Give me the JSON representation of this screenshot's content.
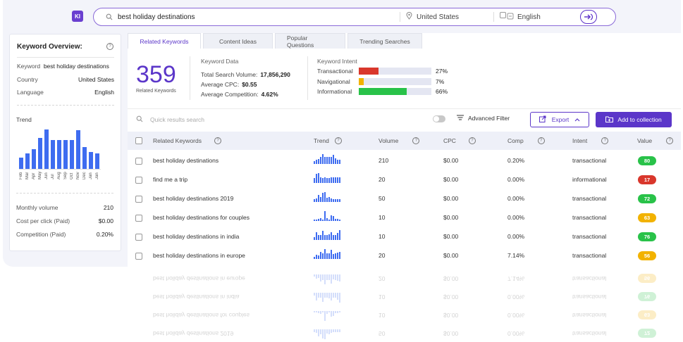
{
  "app": {
    "logo": "KI"
  },
  "search": {
    "query": "best holiday destinations",
    "country": "United States",
    "language": "English"
  },
  "overview": {
    "title": "Keyword Overview:",
    "keyword_label": "Keyword",
    "keyword_value": "best holiday destinations",
    "country_label": "Country",
    "country_value": "United States",
    "language_label": "Language",
    "language_value": "English",
    "trend_label": "Trend",
    "trend_values": [
      0.28,
      0.4,
      0.5,
      0.78,
      1.0,
      0.74,
      0.74,
      0.74,
      0.74,
      0.98,
      0.56,
      0.42,
      0.4
    ],
    "months": [
      "Feb",
      "Mar",
      "Apr",
      "May",
      "Jun",
      "Jul",
      "Aug",
      "Sep",
      "Oct",
      "Nov",
      "Dec",
      "Jan",
      "Jan"
    ],
    "monthly_volume_label": "Monthly volume",
    "monthly_volume_value": "210",
    "cpc_label": "Cost per click (Paid)",
    "cpc_value": "$0.00",
    "competition_label": "Competition (Paid)",
    "competition_value": "0.20%"
  },
  "tabs": [
    "Related Keywords",
    "Content Ideas",
    "Popular Questions",
    "Trending Searches"
  ],
  "summary": {
    "count": "359",
    "count_caption": "Related Keywords",
    "data_title": "Keyword Data",
    "total_volume_label": "Total Search Volume:",
    "total_volume_value": "17,856,290",
    "avg_cpc_label": "Average CPC:",
    "avg_cpc_value": "$0.55",
    "avg_comp_label": "Average Competition:",
    "avg_comp_value": "4.62%",
    "intent_title": "Keyword Intent",
    "intents": [
      {
        "label": "Transactional",
        "percent": "27%",
        "fraction": 0.27,
        "color": "#d9372c"
      },
      {
        "label": "Navigational",
        "percent": "7%",
        "fraction": 0.07,
        "color": "#f2b200"
      },
      {
        "label": "Informational",
        "percent": "66%",
        "fraction": 0.66,
        "color": "#29c249"
      }
    ]
  },
  "toolbar": {
    "search_placeholder": "Quick results search",
    "advanced_filter": "Advanced Filter",
    "export": "Export",
    "add_to_collection": "Add to collection"
  },
  "table": {
    "headers": [
      "Related Keywords",
      "Trend",
      "Volume",
      "CPC",
      "Comp",
      "Intent",
      "Value"
    ],
    "rows": [
      {
        "keyword": "best holiday destinations",
        "volume": "210",
        "cpc": "$0.00",
        "comp": "0.20%",
        "intent": "transactional",
        "value": "80",
        "color": "#29c249",
        "trend": [
          0.3,
          0.45,
          0.5,
          0.7,
          1.0,
          0.7,
          0.7,
          0.7,
          0.7,
          0.95,
          0.55,
          0.4,
          0.4
        ]
      },
      {
        "keyword": "find me a trip",
        "volume": "20",
        "cpc": "$0.00",
        "comp": "0.00%",
        "intent": "informational",
        "value": "17",
        "color": "#d9372c",
        "trend": [
          0.5,
          0.9,
          1.0,
          0.6,
          0.5,
          0.55,
          0.5,
          0.5,
          0.55,
          0.6,
          0.6,
          0.55,
          0.6
        ]
      },
      {
        "keyword": "best holiday destinations 2019",
        "volume": "50",
        "cpc": "$0.00",
        "comp": "0.00%",
        "intent": "transactional",
        "value": "72",
        "color": "#29c249",
        "trend": [
          0.3,
          0.35,
          0.7,
          0.5,
          0.9,
          1.0,
          0.4,
          0.5,
          0.35,
          0.3,
          0.3,
          0.25,
          0.25
        ]
      },
      {
        "keyword": "best holiday destinations for couples",
        "volume": "10",
        "cpc": "$0.00",
        "comp": "0.00%",
        "intent": "transactional",
        "value": "63",
        "color": "#f2b200",
        "trend": [
          0.15,
          0.15,
          0.2,
          0.25,
          0.15,
          1.0,
          0.3,
          0.15,
          0.55,
          0.5,
          0.2,
          0.2,
          0.15
        ]
      },
      {
        "keyword": "best holiday destinations in india",
        "volume": "10",
        "cpc": "$0.00",
        "comp": "0.00%",
        "intent": "transactional",
        "value": "76",
        "color": "#29c249",
        "trend": [
          0.3,
          0.8,
          0.5,
          0.5,
          0.9,
          0.5,
          0.5,
          0.55,
          0.8,
          0.5,
          0.5,
          0.7,
          1.0
        ]
      },
      {
        "keyword": "best holiday destinations in europe",
        "volume": "20",
        "cpc": "$0.00",
        "comp": "7.14%",
        "intent": "transactional",
        "value": "56",
        "color": "#f2b200",
        "trend": [
          0.2,
          0.4,
          0.35,
          0.7,
          0.6,
          1.0,
          0.6,
          0.6,
          0.95,
          0.5,
          0.6,
          0.65,
          0.7
        ]
      }
    ]
  }
}
